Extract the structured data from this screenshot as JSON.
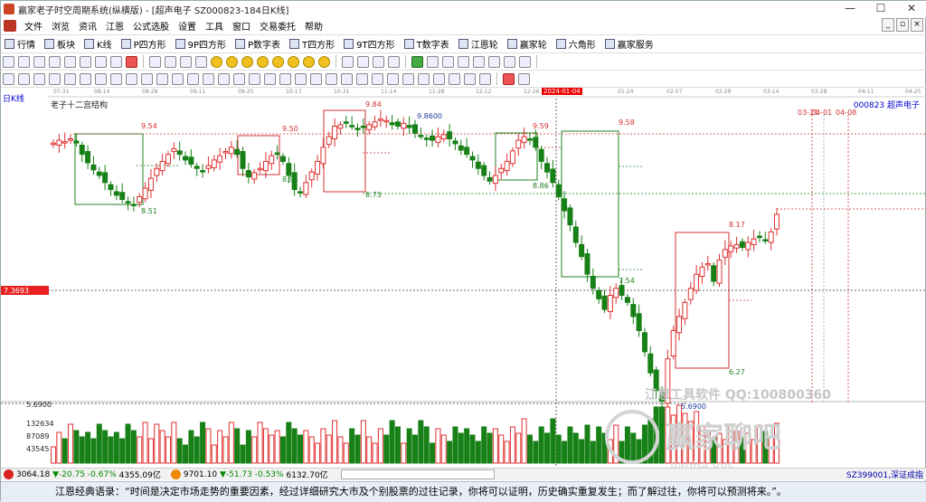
{
  "window": {
    "title": "赢家老子时空周期系统(纵横版) - [超声电子  SZ000823-184日K线]"
  },
  "menu": [
    "文件",
    "浏览",
    "资讯",
    "江恩",
    "公式选股",
    "设置",
    "工具",
    "窗口",
    "交易委托",
    "帮助"
  ],
  "toolbar": [
    "行情",
    "板块",
    "K线",
    "P四方形",
    "9P四方形",
    "P数字表",
    "T四方形",
    "9T四方形",
    "T数字表",
    "江恩轮",
    "赢家轮",
    "六角形",
    "赢家服务"
  ],
  "toolbar_icon_names": [
    "quotes-icon",
    "sector-icon",
    "kline-icon",
    "square-p-icon",
    "square-9p-icon",
    "number-table-p-icon",
    "square-t-icon",
    "square-9t-icon",
    "number-table-t-icon",
    "gann-wheel-icon",
    "winner-wheel-icon",
    "hexagon-icon",
    "service-icon"
  ],
  "chart": {
    "period_label": "日K线",
    "title": "老子十二宫结构",
    "stock_code": "000823",
    "stock_name": "超声电子",
    "date_ticks": [
      "07-31",
      "08-14",
      "08-28",
      "09-11",
      "09-25",
      "10-17",
      "10-31",
      "11-14",
      "11-28",
      "12-12",
      "12-26",
      "2024-01-04",
      "01-24",
      "02-07",
      "02-29",
      "03-14",
      "03-28",
      "04-11",
      "04-25"
    ],
    "highlight_date": "2024-01-04",
    "future_labels": [
      "03-21",
      "04-01",
      "04-08"
    ],
    "current_price_tag": "7.3693",
    "price_labels": [
      {
        "text": "9.54",
        "color": "#d03030"
      },
      {
        "text": "8.51",
        "color": "#208020"
      },
      {
        "text": "9.50",
        "color": "#d03030"
      },
      {
        "text": "8.94",
        "color": "#208020"
      },
      {
        "text": "9.84",
        "color": "#d03030"
      },
      {
        "text": "8.73",
        "color": "#208020"
      },
      {
        "text": "9.8600",
        "color": "#2040a0"
      },
      {
        "text": "9.59",
        "color": "#d03030"
      },
      {
        "text": "8.86",
        "color": "#208020"
      },
      {
        "text": "9.58",
        "color": "#d03030"
      },
      {
        "text": "7.54",
        "color": "#208020"
      },
      {
        "text": "8.17",
        "color": "#d03030"
      },
      {
        "text": "6.27",
        "color": "#208020"
      },
      {
        "text": "5.6900",
        "color": "#2040a0"
      }
    ],
    "volume_axis": [
      "5.6900",
      "132634",
      "87089",
      "43545"
    ],
    "watermark": [
      "江恩工具软件  QQ:100800360",
      "赢家聊吧",
      "jiaoba.yvs"
    ]
  },
  "chart_data": {
    "type": "candlestick",
    "series": [
      {
        "name": "超声电子",
        "x_range": [
          "07-31",
          "04-25"
        ],
        "y_range": [
          5.69,
          9.86
        ]
      }
    ],
    "levels": [
      9.54,
      8.51,
      9.5,
      8.94,
      9.84,
      8.73,
      9.86,
      9.59,
      8.86,
      9.58,
      7.54,
      8.17,
      6.27,
      5.69,
      7.3693
    ],
    "volume_ticks": [
      132634,
      87089,
      43545
    ]
  },
  "status": {
    "sh": {
      "value": "3064.18",
      "change": "▼-20.75",
      "pct": "-0.67%",
      "amount": "4355.09亿"
    },
    "sz": {
      "value": "9701.10",
      "change": "▼-51.73",
      "pct": "-0.53%",
      "amount": "6132.70亿"
    },
    "right": "SZ399001,深证成指"
  },
  "quote": "江恩经典语录：“时间是决定市场走势的重要因素，经过详细研究大市及个别股票的过往记录，你将可以证明，历史确实重复发生；而了解过往，你将可以预测将来。”。",
  "colors": {
    "up": "#e03030",
    "down": "#178017",
    "box_red": "#d03030",
    "box_green": "#208020",
    "price_tag": "#e82020"
  }
}
